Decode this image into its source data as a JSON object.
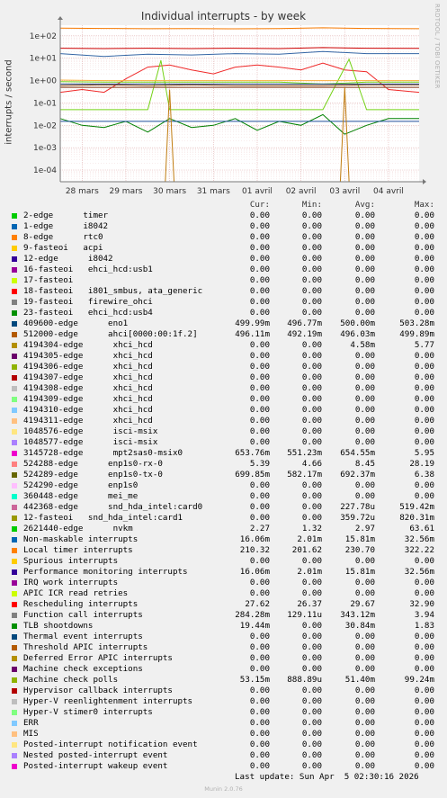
{
  "header": {
    "title": "Individual interrupts - by week",
    "side_label": "RRDTOOL / TOBI OETIKER",
    "ylabel": "interrupts / second"
  },
  "chart_data": {
    "type": "line",
    "title": "Individual interrupts - by week",
    "ylabel": "interrupts / second",
    "yscale": "log",
    "ylim": [
      3e-05,
      300
    ],
    "y_ticks": [
      "1e+02",
      "1e+01",
      "1e+00",
      "1e-01",
      "1e-02",
      "1e-03",
      "1e-04"
    ],
    "y_tick_values": [
      100,
      10,
      1,
      0.1,
      0.01,
      0.001,
      0.0001
    ],
    "x_ticks": [
      "28 mars",
      "29 mars",
      "30 mars",
      "31 mars",
      "01 avril",
      "02 avril",
      "03 avril",
      "04 avril"
    ],
    "x_tick_values": [
      0.5,
      1.5,
      2.5,
      3.5,
      4.5,
      5.5,
      6.5,
      7.5
    ],
    "xlim": [
      0,
      8.2
    ],
    "grid": true,
    "series": [
      {
        "name": "Local timer interrupts",
        "color": "#f57900",
        "x": [
          0,
          1,
          2,
          3,
          4,
          5,
          6,
          7,
          8.2
        ],
        "values": [
          220,
          215,
          210,
          212,
          208,
          211,
          230,
          214,
          210
        ]
      },
      {
        "name": "Rescheduling interrupts",
        "color": "#cc0000",
        "x": [
          0,
          1,
          2,
          3,
          4,
          5,
          6,
          7,
          8.2
        ],
        "values": [
          28,
          27,
          28,
          27,
          28,
          27,
          30,
          28,
          27.6
        ]
      },
      {
        "name": "Non-maskable interrupts",
        "color": "#3465a4",
        "x": [
          0,
          1,
          2,
          3,
          4,
          5,
          6,
          7,
          8.2
        ],
        "values": [
          16,
          12,
          15,
          14,
          16,
          15,
          20,
          16,
          16
        ]
      },
      {
        "name": "Function call interrupts",
        "color": "#ef2929",
        "x": [
          0,
          0.5,
          1,
          1.5,
          2,
          2.5,
          3,
          3.5,
          4,
          4.5,
          5,
          5.5,
          6,
          6.5,
          7,
          7.5,
          8.2
        ],
        "values": [
          0.3,
          0.4,
          0.3,
          1.2,
          4,
          5,
          3,
          2,
          4,
          5,
          4,
          3,
          6,
          3,
          2.5,
          0.4,
          0.3
        ]
      },
      {
        "name": "Machine check polls",
        "color": "#73d216",
        "x": [
          0,
          1,
          2,
          2.3,
          2.5,
          3,
          4,
          5,
          6,
          6.6,
          7,
          8.2
        ],
        "values": [
          0.05,
          0.05,
          0.05,
          8,
          0.05,
          0.05,
          0.05,
          0.05,
          0.05,
          9,
          0.05,
          0.05
        ]
      },
      {
        "name": "9-fasteoi acpi",
        "color": "#fcaf3e",
        "x": [
          0,
          1,
          2,
          3,
          4,
          5,
          6,
          7,
          8.2
        ],
        "values": [
          1.05,
          1.0,
          1.0,
          1.0,
          1.0,
          1.0,
          1.0,
          1.0,
          1.0
        ]
      },
      {
        "name": "19-fasteoi firewire_ohci",
        "color": "#73d216",
        "x": [
          0,
          1,
          2,
          3,
          4,
          5,
          6,
          7,
          8.2
        ],
        "values": [
          0.9,
          0.85,
          0.85,
          0.85,
          0.85,
          0.85,
          0.7,
          0.85,
          0.85
        ]
      },
      {
        "name": "409600-edge eno1",
        "color": "#555753",
        "x": [
          0,
          1,
          2,
          3,
          4,
          5,
          6,
          7,
          8.2
        ],
        "values": [
          0.5,
          0.5,
          0.5,
          0.5,
          0.5,
          0.5,
          0.5,
          0.5,
          0.5
        ]
      },
      {
        "name": "512000-edge ahci[0000:00:1f.2]",
        "color": "#a0522d",
        "x": [
          0,
          1,
          2,
          3,
          4,
          5,
          6,
          7,
          8.2
        ],
        "values": [
          0.5,
          0.5,
          0.5,
          0.5,
          0.5,
          0.5,
          0.5,
          0.5,
          0.5
        ]
      },
      {
        "name": "3145728-edge mpt2sas0-msix0",
        "color": "#8b4513",
        "x": [
          0,
          1,
          2,
          3,
          4,
          5,
          6,
          7,
          8.2
        ],
        "values": [
          0.6,
          0.65,
          0.6,
          0.65,
          0.6,
          0.6,
          0.6,
          0.65,
          0.65
        ]
      },
      {
        "name": "524289-edge enp1s0-tx-0",
        "color": "#204a87",
        "x": [
          0,
          1,
          2,
          3,
          4,
          5,
          6,
          7,
          8.2
        ],
        "values": [
          0.7,
          0.7,
          0.7,
          0.7,
          0.7,
          0.7,
          0.7,
          0.7,
          0.7
        ]
      },
      {
        "name": "TLB shootdowns",
        "color": "#008000",
        "x": [
          0,
          0.5,
          1,
          1.5,
          2,
          2.5,
          3,
          3.5,
          4,
          4.5,
          5,
          5.5,
          6,
          6.5,
          7,
          7.5,
          8.2
        ],
        "values": [
          0.02,
          0.01,
          0.008,
          0.015,
          0.005,
          0.02,
          0.008,
          0.01,
          0.02,
          0.006,
          0.015,
          0.01,
          0.03,
          0.004,
          0.01,
          0.02,
          0.02
        ]
      },
      {
        "name": "1-edge i8042",
        "color": "#1f4e9a",
        "x": [
          0,
          1,
          2,
          3,
          4,
          5,
          6,
          7,
          8.2
        ],
        "values": [
          0.015,
          0.015,
          0.015,
          0.015,
          0.015,
          0.015,
          0.015,
          0.015,
          0.015
        ]
      },
      {
        "name": "442368-edge snd_hda_intel:card0",
        "color": "#c17d11",
        "x": [
          0,
          2.4,
          2.5,
          2.6,
          6.4,
          6.5,
          6.6,
          8.2
        ],
        "values": [
          1e-05,
          1e-05,
          0.4,
          1e-05,
          1e-05,
          0.5,
          1e-05,
          1e-05
        ]
      }
    ]
  },
  "legend": {
    "headers": {
      "cur": "Cur:",
      "min": "Min:",
      "avg": "Avg:",
      "max": "Max:"
    },
    "rows": [
      {
        "color": "#00cc00",
        "name": "2-edge      timer",
        "cur": "0.00",
        "min": "0.00",
        "avg": "0.00",
        "max": "0.00"
      },
      {
        "color": "#0066b3",
        "name": "1-edge      i8042",
        "cur": "0.00",
        "min": "0.00",
        "avg": "0.00",
        "max": "0.00"
      },
      {
        "color": "#ff8000",
        "name": "8-edge      rtc0",
        "cur": "0.00",
        "min": "0.00",
        "avg": "0.00",
        "max": "0.00"
      },
      {
        "color": "#ffcc00",
        "name": "9-fasteoi   acpi",
        "cur": "0.00",
        "min": "0.00",
        "avg": "0.00",
        "max": "0.00"
      },
      {
        "color": "#330099",
        "name": "12-edge      i8042",
        "cur": "0.00",
        "min": "0.00",
        "avg": "0.00",
        "max": "0.00"
      },
      {
        "color": "#990099",
        "name": "16-fasteoi   ehci_hcd:usb1",
        "cur": "0.00",
        "min": "0.00",
        "avg": "0.00",
        "max": "0.00"
      },
      {
        "color": "#ccff00",
        "name": "17-fasteoi",
        "cur": "0.00",
        "min": "0.00",
        "avg": "0.00",
        "max": "0.00"
      },
      {
        "color": "#ff0000",
        "name": "18-fasteoi   i801_smbus, ata_generic",
        "cur": "0.00",
        "min": "0.00",
        "avg": "0.00",
        "max": "0.00"
      },
      {
        "color": "#808080",
        "name": "19-fasteoi   firewire_ohci",
        "cur": "0.00",
        "min": "0.00",
        "avg": "0.00",
        "max": "0.00"
      },
      {
        "color": "#008f00",
        "name": "23-fasteoi   ehci_hcd:usb4",
        "cur": "0.00",
        "min": "0.00",
        "avg": "0.00",
        "max": "0.00"
      },
      {
        "color": "#00487d",
        "name": "409600-edge      eno1",
        "cur": "499.99m",
        "min": "496.77m",
        "avg": "500.00m",
        "max": "503.28m"
      },
      {
        "color": "#b35a00",
        "name": "512000-edge      ahci[0000:00:1f.2]",
        "cur": "496.11m",
        "min": "492.19m",
        "avg": "496.03m",
        "max": "499.89m"
      },
      {
        "color": "#b38f00",
        "name": "4194304-edge      xhci_hcd",
        "cur": "0.00",
        "min": "0.00",
        "avg": "4.58m",
        "max": "5.77"
      },
      {
        "color": "#6b006b",
        "name": "4194305-edge      xhci_hcd",
        "cur": "0.00",
        "min": "0.00",
        "avg": "0.00",
        "max": "0.00"
      },
      {
        "color": "#8fb300",
        "name": "4194306-edge      xhci_hcd",
        "cur": "0.00",
        "min": "0.00",
        "avg": "0.00",
        "max": "0.00"
      },
      {
        "color": "#b30000",
        "name": "4194307-edge      xhci_hcd",
        "cur": "0.00",
        "min": "0.00",
        "avg": "0.00",
        "max": "0.00"
      },
      {
        "color": "#bebebe",
        "name": "4194308-edge      xhci_hcd",
        "cur": "0.00",
        "min": "0.00",
        "avg": "0.00",
        "max": "0.00"
      },
      {
        "color": "#80ff80",
        "name": "4194309-edge      xhci_hcd",
        "cur": "0.00",
        "min": "0.00",
        "avg": "0.00",
        "max": "0.00"
      },
      {
        "color": "#80c9ff",
        "name": "4194310-edge      xhci_hcd",
        "cur": "0.00",
        "min": "0.00",
        "avg": "0.00",
        "max": "0.00"
      },
      {
        "color": "#ffc080",
        "name": "4194311-edge      xhci_hcd",
        "cur": "0.00",
        "min": "0.00",
        "avg": "0.00",
        "max": "0.00"
      },
      {
        "color": "#ffe680",
        "name": "1048576-edge      isci-msix",
        "cur": "0.00",
        "min": "0.00",
        "avg": "0.00",
        "max": "0.00"
      },
      {
        "color": "#aa80ff",
        "name": "1048577-edge      isci-msix",
        "cur": "0.00",
        "min": "0.00",
        "avg": "0.00",
        "max": "0.00"
      },
      {
        "color": "#ee00cc",
        "name": "3145728-edge      mpt2sas0-msix0",
        "cur": "653.76m",
        "min": "551.23m",
        "avg": "654.55m",
        "max": "5.95"
      },
      {
        "color": "#ff8080",
        "name": "524288-edge      enp1s0-rx-0",
        "cur": "5.39",
        "min": "4.66",
        "avg": "8.45",
        "max": "28.19"
      },
      {
        "color": "#666600",
        "name": "524289-edge      enp1s0-tx-0",
        "cur": "699.85m",
        "min": "582.17m",
        "avg": "692.37m",
        "max": "6.38"
      },
      {
        "color": "#ffbfff",
        "name": "524290-edge      enp1s0",
        "cur": "0.00",
        "min": "0.00",
        "avg": "0.00",
        "max": "0.00"
      },
      {
        "color": "#00ffcc",
        "name": "360448-edge      mei_me",
        "cur": "0.00",
        "min": "0.00",
        "avg": "0.00",
        "max": "0.00"
      },
      {
        "color": "#cc6699",
        "name": "442368-edge      snd_hda_intel:card0",
        "cur": "0.00",
        "min": "0.00",
        "avg": "227.78u",
        "max": "519.42m"
      },
      {
        "color": "#999900",
        "name": "12-fasteoi   snd_hda_intel:card1",
        "cur": "0.00",
        "min": "0.00",
        "avg": "359.72u",
        "max": "820.31m"
      },
      {
        "color": "#00cc00",
        "name": "2621440-edge      nvkm",
        "cur": "2.27",
        "min": "1.32",
        "avg": "2.97",
        "max": "63.61"
      },
      {
        "color": "#0066b3",
        "name": "Non-maskable interrupts",
        "cur": "16.06m",
        "min": "2.01m",
        "avg": "15.81m",
        "max": "32.56m"
      },
      {
        "color": "#ff8000",
        "name": "Local timer interrupts",
        "cur": "210.32",
        "min": "201.62",
        "avg": "230.70",
        "max": "322.22"
      },
      {
        "color": "#ffcc00",
        "name": "Spurious interrupts",
        "cur": "0.00",
        "min": "0.00",
        "avg": "0.00",
        "max": "0.00"
      },
      {
        "color": "#330099",
        "name": "Performance monitoring interrupts",
        "cur": "16.06m",
        "min": "2.01m",
        "avg": "15.81m",
        "max": "32.56m"
      },
      {
        "color": "#990099",
        "name": "IRQ work interrupts",
        "cur": "0.00",
        "min": "0.00",
        "avg": "0.00",
        "max": "0.00"
      },
      {
        "color": "#ccff00",
        "name": "APIC ICR read retries",
        "cur": "0.00",
        "min": "0.00",
        "avg": "0.00",
        "max": "0.00"
      },
      {
        "color": "#ff0000",
        "name": "Rescheduling interrupts",
        "cur": "27.62",
        "min": "26.37",
        "avg": "29.67",
        "max": "32.90"
      },
      {
        "color": "#808080",
        "name": "Function call interrupts",
        "cur": "284.28m",
        "min": "129.11u",
        "avg": "343.12m",
        "max": "3.94"
      },
      {
        "color": "#008f00",
        "name": "TLB shootdowns",
        "cur": "19.44m",
        "min": "0.00",
        "avg": "30.84m",
        "max": "1.83"
      },
      {
        "color": "#00487d",
        "name": "Thermal event interrupts",
        "cur": "0.00",
        "min": "0.00",
        "avg": "0.00",
        "max": "0.00"
      },
      {
        "color": "#b35a00",
        "name": "Threshold APIC interrupts",
        "cur": "0.00",
        "min": "0.00",
        "avg": "0.00",
        "max": "0.00"
      },
      {
        "color": "#b38f00",
        "name": "Deferred Error APIC interrupts",
        "cur": "0.00",
        "min": "0.00",
        "avg": "0.00",
        "max": "0.00"
      },
      {
        "color": "#6b006b",
        "name": "Machine check exceptions",
        "cur": "0.00",
        "min": "0.00",
        "avg": "0.00",
        "max": "0.00"
      },
      {
        "color": "#8fb300",
        "name": "Machine check polls",
        "cur": "53.15m",
        "min": "888.89u",
        "avg": "51.40m",
        "max": "99.24m"
      },
      {
        "color": "#b30000",
        "name": "Hypervisor callback interrupts",
        "cur": "0.00",
        "min": "0.00",
        "avg": "0.00",
        "max": "0.00"
      },
      {
        "color": "#bebebe",
        "name": "Hyper-V reenlightenment interrupts",
        "cur": "0.00",
        "min": "0.00",
        "avg": "0.00",
        "max": "0.00"
      },
      {
        "color": "#80ff80",
        "name": "Hyper-V stimer0 interrupts",
        "cur": "0.00",
        "min": "0.00",
        "avg": "0.00",
        "max": "0.00"
      },
      {
        "color": "#80c9ff",
        "name": "ERR",
        "cur": "0.00",
        "min": "0.00",
        "avg": "0.00",
        "max": "0.00"
      },
      {
        "color": "#ffc080",
        "name": "MIS",
        "cur": "0.00",
        "min": "0.00",
        "avg": "0.00",
        "max": "0.00"
      },
      {
        "color": "#ffe680",
        "name": "Posted-interrupt notification event",
        "cur": "0.00",
        "min": "0.00",
        "avg": "0.00",
        "max": "0.00"
      },
      {
        "color": "#aa80ff",
        "name": "Nested posted-interrupt event",
        "cur": "0.00",
        "min": "0.00",
        "avg": "0.00",
        "max": "0.00"
      },
      {
        "color": "#ee00cc",
        "name": "Posted-interrupt wakeup event",
        "cur": "0.00",
        "min": "0.00",
        "avg": "0.00",
        "max": "0.00"
      }
    ]
  },
  "footer": {
    "last_update": "Last update: Sun Apr  5 02:30:16 2026",
    "munin": "Munin 2.0.76"
  }
}
